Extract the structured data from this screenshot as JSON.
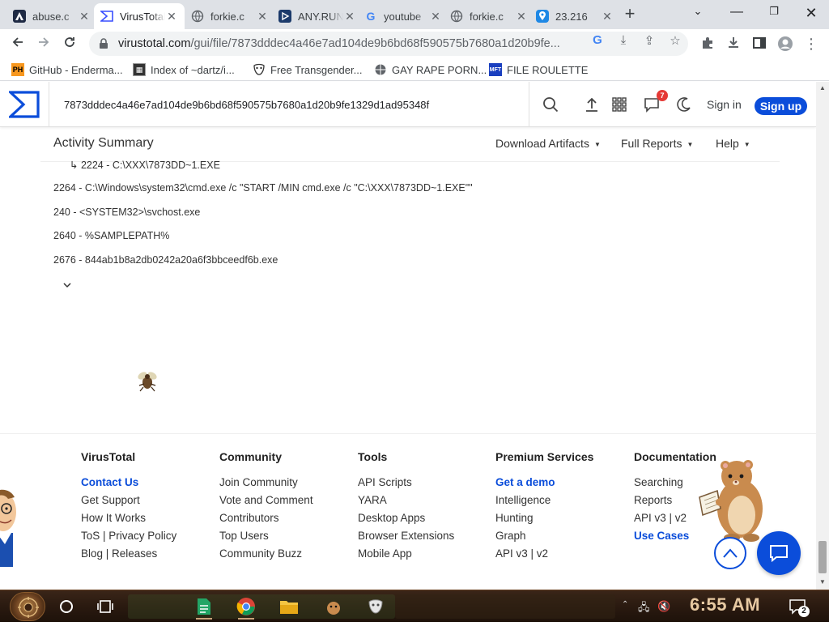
{
  "browser": {
    "tabs": [
      {
        "title": "abuse.c",
        "favicon": "abuse-favicon",
        "active": false
      },
      {
        "title": "VirusTotal",
        "favicon": "virustotal-favicon",
        "active": true
      },
      {
        "title": "forkie.c",
        "favicon": "globe-favicon",
        "active": false
      },
      {
        "title": "ANY.RUN",
        "favicon": "anyrun-favicon",
        "active": false
      },
      {
        "title": "youtube",
        "favicon": "google-favicon",
        "active": false
      },
      {
        "title": "forkie.c",
        "favicon": "globe-favicon",
        "active": false
      },
      {
        "title": "23.216",
        "favicon": "location-favicon",
        "active": false
      }
    ],
    "url_host": "virustotal.com",
    "url_path": "/gui/file/7873dddec4a46e7ad104de9b6bd68f590575b7680a1d20b9fe...",
    "bookmarks": [
      {
        "label": "GitHub - Enderma...",
        "icon": "ph-icon"
      },
      {
        "label": "Index of ~dartz/i...",
        "icon": "folder-icon"
      },
      {
        "label": "Free Transgender...",
        "icon": "mask-icon"
      },
      {
        "label": "GAY RAPE PORN...",
        "icon": "globe-icon"
      },
      {
        "label": "FILE ROULETTE",
        "icon": "mft-icon"
      }
    ]
  },
  "vt": {
    "search_value": "7873dddec4a46e7ad104de9b6bd68f590575b7680a1d20b9fe1329d1ad95348f",
    "notification_count": "7",
    "signin": "Sign in",
    "signup": "Sign up",
    "activity_title": "Activity Summary",
    "menus": {
      "download": "Download Artifacts",
      "reports": "Full Reports",
      "help": "Help"
    },
    "processes": [
      "↳ 2224 - C:\\XXX\\7873DD~1.EXE",
      "2264 - C:\\Windows\\system32\\cmd.exe /c \"START /MIN cmd.exe /c \"C:\\XXX\\7873DD~1.EXE\"\"",
      "240 - <SYSTEM32>\\svchost.exe",
      "2640 - %SAMPLEPATH%",
      "2676 - 844ab1b8a2db0242a20a6f3bbceedf6b.exe"
    ]
  },
  "footer": {
    "columns": [
      {
        "title": "VirusTotal",
        "links": [
          {
            "label": "Contact Us",
            "hl": true
          },
          {
            "label": "Get Support",
            "hl": false
          },
          {
            "label": "How It Works",
            "hl": false
          },
          {
            "label": "ToS | Privacy Policy",
            "hl": false
          },
          {
            "label": "Blog | Releases",
            "hl": false
          }
        ]
      },
      {
        "title": "Community",
        "links": [
          {
            "label": "Join Community",
            "hl": false
          },
          {
            "label": "Vote and Comment",
            "hl": false
          },
          {
            "label": "Contributors",
            "hl": false
          },
          {
            "label": "Top Users",
            "hl": false
          },
          {
            "label": "Community Buzz",
            "hl": false
          }
        ]
      },
      {
        "title": "Tools",
        "links": [
          {
            "label": "API Scripts",
            "hl": false
          },
          {
            "label": "YARA",
            "hl": false
          },
          {
            "label": "Desktop Apps",
            "hl": false
          },
          {
            "label": "Browser Extensions",
            "hl": false
          },
          {
            "label": "Mobile App",
            "hl": false
          }
        ]
      },
      {
        "title": "Premium Services",
        "links": [
          {
            "label": "Get a demo",
            "hl": true
          },
          {
            "label": "Intelligence",
            "hl": false
          },
          {
            "label": "Hunting",
            "hl": false
          },
          {
            "label": "Graph",
            "hl": false
          },
          {
            "label": "API v3 | v2",
            "hl": false
          }
        ]
      },
      {
        "title": "Documentation",
        "links": [
          {
            "label": "Searching",
            "hl": false
          },
          {
            "label": "Reports",
            "hl": false
          },
          {
            "label": "API v3 | v2",
            "hl": false
          },
          {
            "label": "Use Cases",
            "hl": true
          }
        ]
      }
    ]
  },
  "taskbar": {
    "clock": "6:55 AM",
    "notification_count": "2"
  },
  "colors": {
    "vt_blue": "#0b4dda",
    "tab_strip": "#dee1e6",
    "taskbar_brown": "#2a1a10"
  }
}
